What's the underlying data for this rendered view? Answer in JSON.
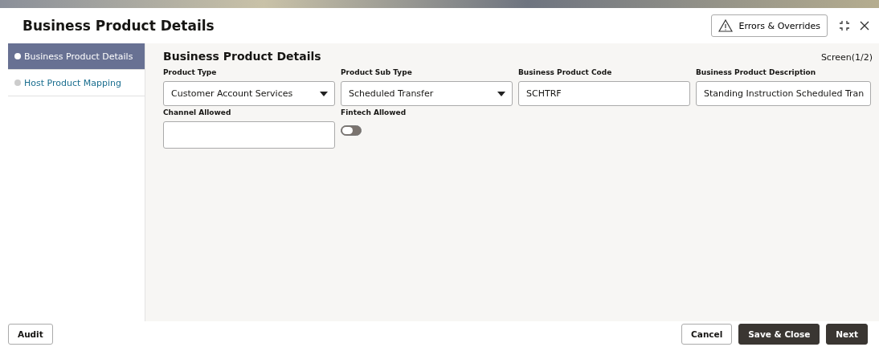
{
  "window": {
    "title": "Business Product Details"
  },
  "header_actions": {
    "errors_button": "Errors & Overrides"
  },
  "sidebar": {
    "items": [
      {
        "label": "Business Product Details",
        "selected": true
      },
      {
        "label": "Host Product Mapping",
        "selected": false
      }
    ]
  },
  "section": {
    "title": "Business Product Details",
    "screen_indicator": "Screen(1/2)"
  },
  "fields": [
    {
      "kind": "dropdown",
      "label": "Product Type",
      "value": "Customer Account Services"
    },
    {
      "kind": "dropdown",
      "label": "Product Sub Type",
      "value": "Scheduled Transfer"
    },
    {
      "kind": "text",
      "label": "Business Product Code",
      "value": "SCHTRF"
    },
    {
      "kind": "text",
      "label": "Business Product Description",
      "value": "Standing Instruction Scheduled Tran"
    },
    {
      "kind": "text",
      "label": "Channel Allowed"
    },
    {
      "kind": "toggle",
      "label": "Fintech Allowed",
      "on": false
    }
  ],
  "footer": {
    "left_buttons": [
      {
        "label": "Audit",
        "kind": "outline"
      }
    ],
    "right_buttons": [
      {
        "label": "Cancel",
        "kind": "outline"
      },
      {
        "label": "Save & Close",
        "kind": "dark"
      },
      {
        "label": "Next",
        "kind": "dark"
      }
    ]
  }
}
